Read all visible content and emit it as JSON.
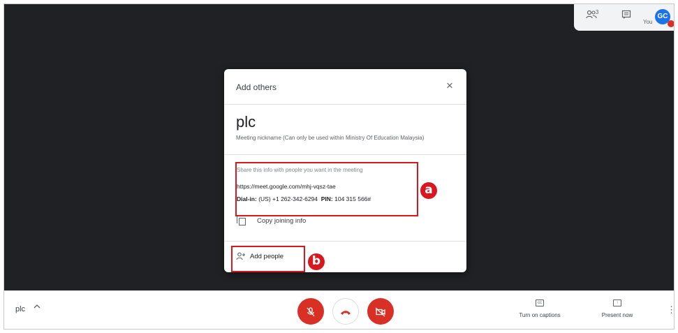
{
  "top_bar": {
    "people_count": "3",
    "you_label": "You",
    "avatar_initials": "GC"
  },
  "dialog": {
    "title": "Add others",
    "close_glyph": "×",
    "meeting_name": "plc",
    "meeting_note": "Meeting nickname (Can only be used within Ministry Of Education Malaysia)",
    "share_text": "Share this info with people you want in the meeting",
    "meeting_url": "https://meet.google.com/mhj-vqsz-tae",
    "dialin_label": "Dial-in:",
    "dialin_number": "(US) +1 262-342-6294",
    "pin_label": "PIN:",
    "pin_value": "104 315 566#",
    "copy_label": "Copy joining info",
    "add_people_label": "Add people"
  },
  "annotations": {
    "marker_a": "a",
    "marker_b": "b",
    "color": "#d7191f"
  },
  "bottom_bar": {
    "meeting_title": "plc",
    "captions_label": "Turn on captions",
    "present_label": "Present now"
  },
  "icons": [
    "people-icon",
    "chat-icon",
    "close-icon",
    "copy-icon",
    "add-person-icon",
    "mic-off-icon",
    "hang-up-icon",
    "camera-off-icon",
    "captions-icon",
    "present-icon",
    "more-icon",
    "chevron-up-icon"
  ]
}
